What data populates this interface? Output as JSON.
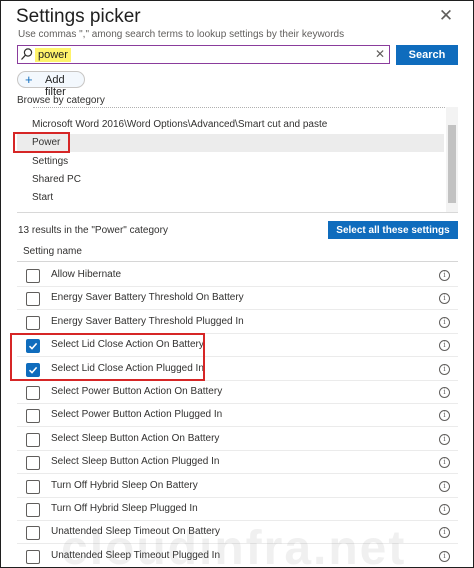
{
  "dialog": {
    "title": "Settings picker",
    "subtitle": "Use commas \",\" among search terms to lookup settings by their keywords",
    "close_icon": "close-icon"
  },
  "search": {
    "value": "power",
    "button_label": "Search",
    "highlight_color": "#fff36b"
  },
  "filter": {
    "add_label": "Add filter"
  },
  "browse": {
    "label": "Browse by category",
    "items": [
      {
        "label": "Microsoft Word 2016\\Word Options\\Advanced\\Smart cut and paste",
        "selected": false
      },
      {
        "label": "Power",
        "selected": true
      },
      {
        "label": "Settings",
        "selected": false
      },
      {
        "label": "Shared PC",
        "selected": false
      },
      {
        "label": "Start",
        "selected": false
      }
    ]
  },
  "results": {
    "summary": "13 results in the \"Power\" category",
    "select_all_label": "Select all these settings",
    "column_header": "Setting name",
    "rows": [
      {
        "label": "Allow Hibernate",
        "checked": false
      },
      {
        "label": "Energy Saver Battery Threshold On Battery",
        "checked": false
      },
      {
        "label": "Energy Saver Battery Threshold Plugged In",
        "checked": false
      },
      {
        "label": "Select Lid Close Action On Battery",
        "checked": true
      },
      {
        "label": "Select Lid Close Action Plugged In",
        "checked": true
      },
      {
        "label": "Select Power Button Action On Battery",
        "checked": false
      },
      {
        "label": "Select Power Button Action Plugged In",
        "checked": false
      },
      {
        "label": "Select Sleep Button Action On Battery",
        "checked": false
      },
      {
        "label": "Select Sleep Button Action Plugged In",
        "checked": false
      },
      {
        "label": "Turn Off Hybrid Sleep On Battery",
        "checked": false
      },
      {
        "label": "Turn Off Hybrid Sleep Plugged In",
        "checked": false
      },
      {
        "label": "Unattended Sleep Timeout On Battery",
        "checked": false
      },
      {
        "label": "Unattended Sleep Timeout Plugged In",
        "checked": false
      }
    ]
  },
  "watermark": "cloudinfra.net",
  "colors": {
    "accent": "#0f6cbd",
    "annotation": "#d62626",
    "search_border": "#8a3c9c"
  }
}
